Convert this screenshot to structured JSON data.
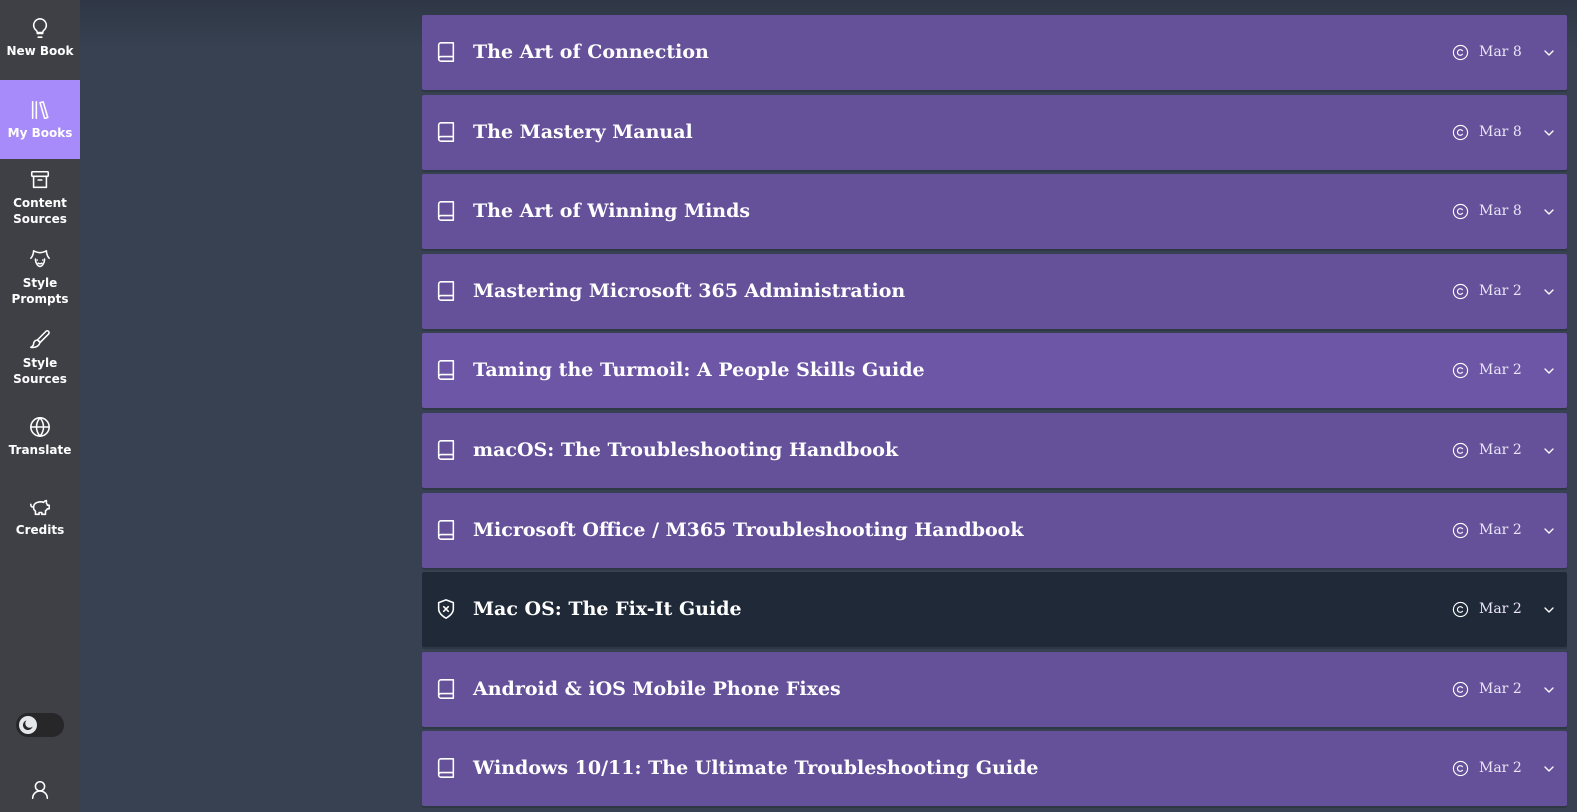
{
  "sidebar": {
    "items": [
      {
        "label": "New Book",
        "icon": "lightbulb-icon"
      },
      {
        "label": "My Books",
        "icon": "books-icon",
        "active": true
      },
      {
        "label": "Content\nSources",
        "icon": "archive-icon"
      },
      {
        "label": "Style\nPrompts",
        "icon": "theater-masks-icon"
      },
      {
        "label": "Style\nSources",
        "icon": "brush-icon"
      },
      {
        "label": "Translate",
        "icon": "globe-icon"
      },
      {
        "label": "Credits",
        "icon": "piggy-bank-icon"
      }
    ],
    "theme_toggle": {
      "icon": "moon-icon",
      "state": "dark"
    },
    "user": {
      "icon": "user-icon"
    }
  },
  "books": [
    {
      "title": "The Art of Connection",
      "date": "Mar 8",
      "icon": "book-icon",
      "style": "normal"
    },
    {
      "title": "The Mastery Manual",
      "date": "Mar 8",
      "icon": "book-icon",
      "style": "normal"
    },
    {
      "title": "The Art of Winning Minds",
      "date": "Mar 8",
      "icon": "book-icon",
      "style": "normal"
    },
    {
      "title": "Mastering Microsoft 365 Administration",
      "date": "Mar 2",
      "icon": "book-icon",
      "style": "normal"
    },
    {
      "title": "Taming the Turmoil: A People Skills Guide",
      "date": "Mar 2",
      "icon": "book-icon",
      "style": "highlight"
    },
    {
      "title": "macOS: The Troubleshooting Handbook",
      "date": "Mar 2",
      "icon": "book-icon",
      "style": "normal"
    },
    {
      "title": "Microsoft Office / M365 Troubleshooting Handbook",
      "date": "Mar 2",
      "icon": "book-icon",
      "style": "normal"
    },
    {
      "title": "Mac OS: The Fix-It Guide",
      "date": "Mar 2",
      "icon": "shield-x-icon",
      "style": "dark"
    },
    {
      "title": "Android & iOS Mobile Phone Fixes",
      "date": "Mar 2",
      "icon": "book-icon",
      "style": "normal"
    },
    {
      "title": "Windows 10/11: The Ultimate Troubleshooting Guide",
      "date": "Mar 2",
      "icon": "book-icon",
      "style": "normal"
    }
  ],
  "colors": {
    "sidebar_bg": "#3f3f46",
    "active_nav": "#a78bfa",
    "row_bg": "#65509a",
    "row_highlight": "#6d56a6",
    "row_dark": "#1f2937",
    "main_bg": "#374151"
  }
}
